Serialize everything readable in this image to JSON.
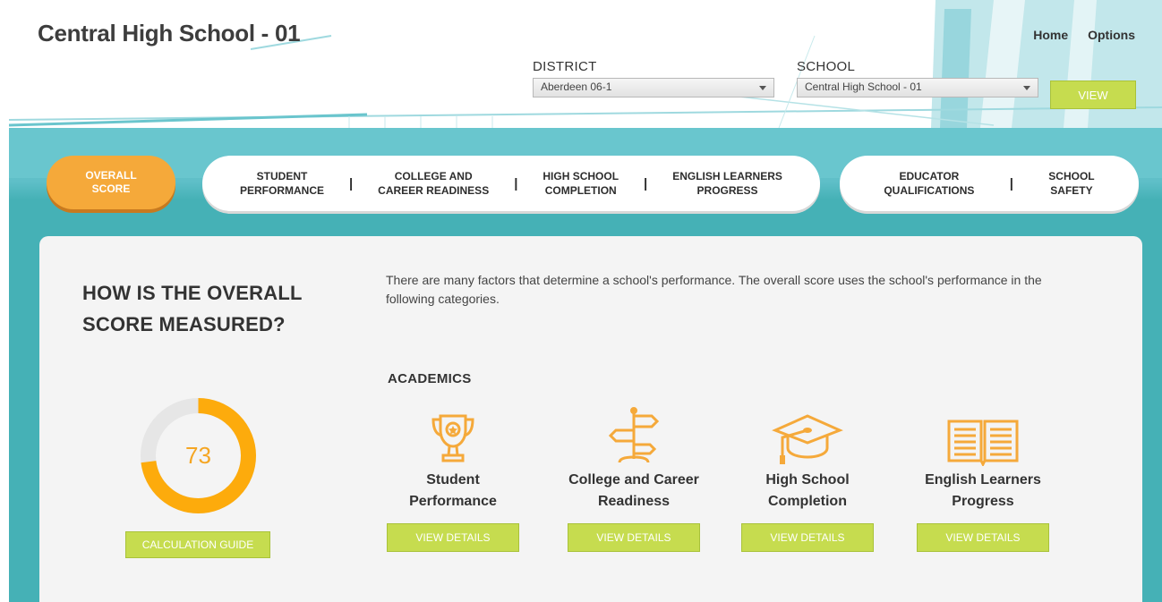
{
  "header": {
    "school_title": "Central High School - 01",
    "links": {
      "home": "Home",
      "options": "Options"
    },
    "district": {
      "label": "DISTRICT",
      "value": "Aberdeen 06-1"
    },
    "school": {
      "label": "SCHOOL",
      "value": "Central High School - 01"
    },
    "view_label": "VIEW"
  },
  "nav": {
    "overall": {
      "line1": "OVERALL",
      "line2": "SCORE"
    },
    "group1": [
      {
        "line1": "STUDENT",
        "line2": "PERFORMANCE"
      },
      {
        "line1": "COLLEGE AND",
        "line2": "CAREER READINESS"
      },
      {
        "line1": "HIGH SCHOOL",
        "line2": "COMPLETION"
      },
      {
        "line1": "ENGLISH LEARNERS",
        "line2": "PROGRESS"
      }
    ],
    "group2": [
      {
        "line1": "EDUCATOR",
        "line2": "QUALIFICATIONS"
      },
      {
        "line1": "SCHOOL",
        "line2": "SAFETY"
      }
    ]
  },
  "main": {
    "question_line1": "HOW IS THE OVERALL",
    "question_line2": "SCORE MEASURED?",
    "intro": "There are many factors that determine a school's performance. The overall score uses the school's performance in the following categories.",
    "section_title": "ACADEMICS",
    "score": "73",
    "score_fraction": 0.73,
    "calc_label": "CALCULATION GUIDE",
    "categories": [
      {
        "line1": "Student",
        "line2": "Performance",
        "icon": "trophy-icon",
        "button": "VIEW DETAILS"
      },
      {
        "line1": "College and Career",
        "line2": "Readiness",
        "icon": "signpost-icon",
        "button": "VIEW DETAILS"
      },
      {
        "line1": "High School",
        "line2": "Completion",
        "icon": "graduation-cap-icon",
        "button": "VIEW DETAILS"
      },
      {
        "line1": "English Learners",
        "line2": "Progress",
        "icon": "open-book-icon",
        "button": "VIEW DETAILS"
      }
    ]
  },
  "colors": {
    "accent_orange": "#f5a93a",
    "button_green": "#c6dc4f",
    "teal": "#45b1b6",
    "gauge_track": "#e6e6e6",
    "gauge_fill": "#fdab0c"
  }
}
